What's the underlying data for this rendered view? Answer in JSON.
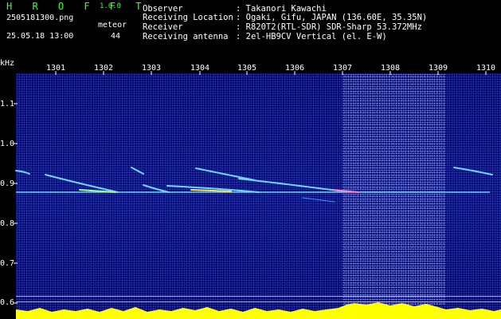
{
  "app": {
    "name": "H R O F F T",
    "version": "1.0.0"
  },
  "file": {
    "name": "2505181300.png",
    "datetime": "25.05.18 13:00"
  },
  "counter": {
    "label": "meteor",
    "value": "44"
  },
  "info": [
    {
      "key": "Observer",
      "value": ": Takanori Kawachi"
    },
    {
      "key": "Receiving Location",
      "value": ": Ogaki, Gifu, JAPAN (136.60E, 35.35N)"
    },
    {
      "key": "Receiver",
      "value": ": R820T2(RTL-SDR) SDR-Sharp 53.372MHz"
    },
    {
      "key": "Receiving antenna",
      "value": ": 2el-HB9CV Vertical (el. E-W)"
    }
  ],
  "x_axis": {
    "ticks": [
      "1301",
      "1302",
      "1303",
      "1304",
      "1305",
      "1306",
      "1307",
      "1308",
      "1309",
      "1310"
    ]
  },
  "y_axis": {
    "unit": "kHz",
    "ticks": [
      "1.1",
      "1.0",
      "0.9",
      "0.8",
      "0.7",
      "0.6"
    ]
  },
  "colors": {
    "accent": "#3cff3c",
    "background": "#000000",
    "spectrum": "#08107a",
    "echo": "#6fd6ff",
    "level": "#ffff00",
    "level_base": "#00e5ff"
  }
}
